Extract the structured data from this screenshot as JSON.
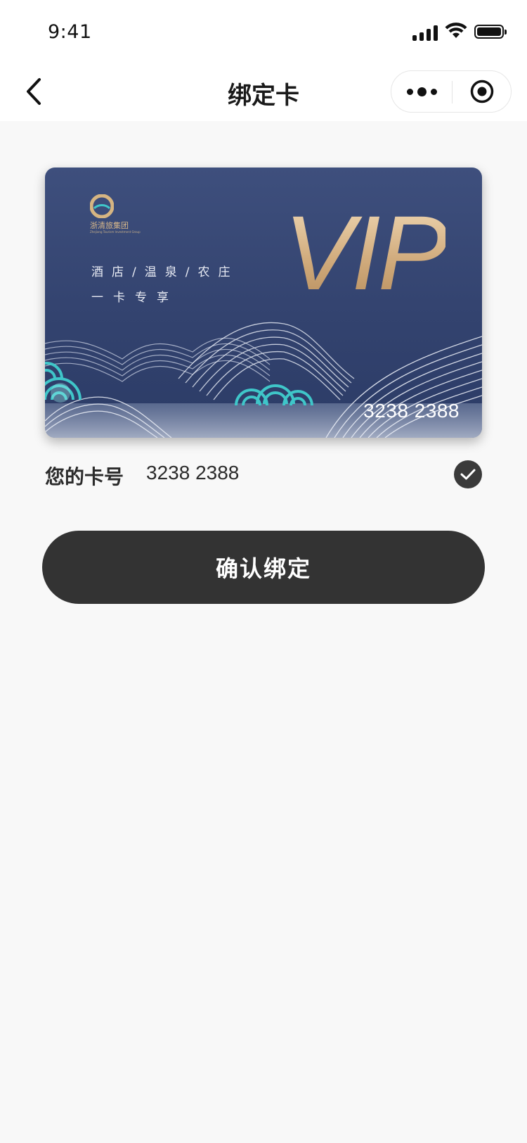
{
  "status_bar": {
    "time": "9:41"
  },
  "nav": {
    "title": "绑定卡",
    "back_icon": "chevron-left-icon",
    "more_icon": "more-dots-icon",
    "close_icon": "target-circle-icon"
  },
  "card": {
    "logo_name": "浙清旅集团",
    "logo_sub": "Zhejiang Tourism Investment Group",
    "slogan_line1": "酒店/温泉/农庄",
    "slogan_line2": "一卡专享",
    "badge": "VIP",
    "number": "3238 2388",
    "colors": {
      "background": "#33436f",
      "gold": "#d9b98c",
      "teal": "#3fc6c9"
    }
  },
  "card_info": {
    "label": "您的卡号",
    "value": "3238 2388",
    "selected_icon": "check-circle-icon"
  },
  "actions": {
    "confirm_label": "确认绑定"
  },
  "theme": {
    "button_color": "#333333",
    "page_background": "#f8f8f8"
  }
}
